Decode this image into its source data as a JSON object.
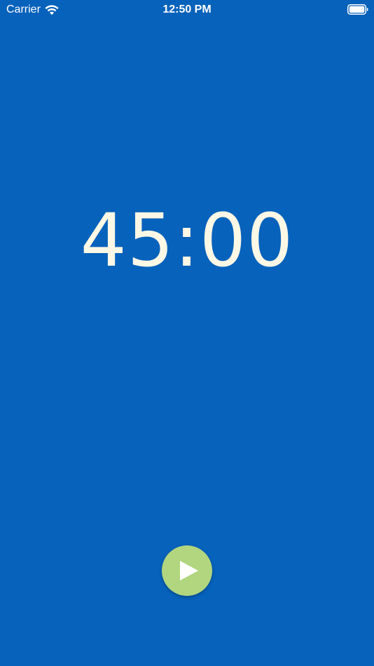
{
  "status_bar": {
    "carrier": "Carrier",
    "time": "12:50 PM",
    "wifi_icon": "wifi-icon",
    "battery_icon": "battery-icon"
  },
  "timer": {
    "display": "45:00"
  },
  "controls": {
    "play_icon": "play-icon"
  },
  "colors": {
    "background": "#0762BB",
    "timer_text": "#FDF7E6",
    "play_button": "#B1D67F",
    "status_text": "#FFFFFF"
  }
}
